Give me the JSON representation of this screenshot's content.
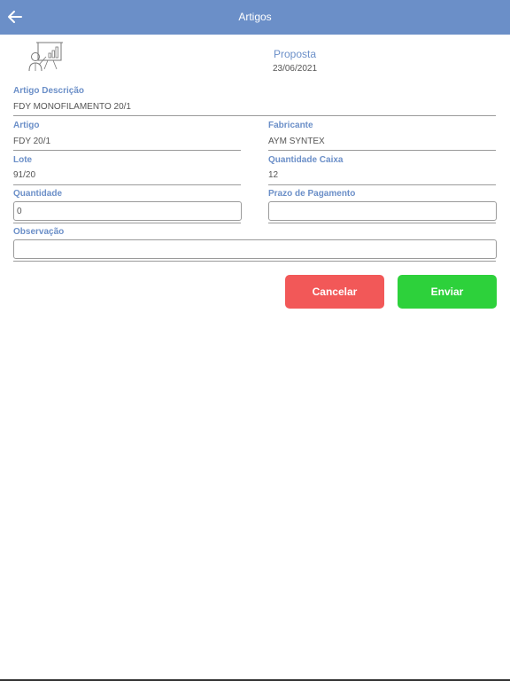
{
  "appbar": {
    "title": "Artigos",
    "back_icon": "arrow-left-icon",
    "color": "#6b8fc8"
  },
  "header": {
    "logo_icon": "presentation-board-icon",
    "title": "Proposta",
    "date": "23/06/2021"
  },
  "form": {
    "artigo_descricao": {
      "label": "Artigo Descrição",
      "value": "FDY MONOFILAMENTO 20/1"
    },
    "artigo": {
      "label": "Artigo",
      "value": "FDY 20/1"
    },
    "fabricante": {
      "label": "Fabricante",
      "value": "AYM SYNTEX"
    },
    "lote": {
      "label": "Lote",
      "value": "91/20"
    },
    "quantidade_caixa": {
      "label": "Quantidade Caixa",
      "value": "12"
    },
    "quantidade": {
      "label": "Quantidade",
      "value": "0"
    },
    "prazo_pagamento": {
      "label": "Prazo de Pagamento",
      "value": ""
    },
    "observacao": {
      "label": "Observação",
      "value": ""
    }
  },
  "actions": {
    "cancel_label": "Cancelar",
    "cancel_color": "#f25858",
    "send_label": "Enviar",
    "send_color": "#2dd13b"
  }
}
